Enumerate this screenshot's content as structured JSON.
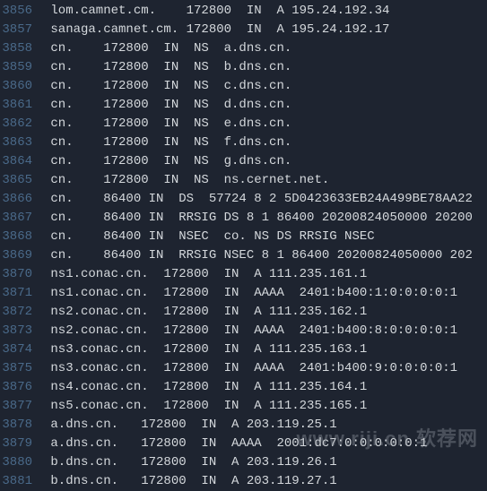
{
  "watermark": "www.riji.cn 软荐网",
  "lines": [
    {
      "num": "3856",
      "text": " lom.camnet.cm.    172800  IN  A 195.24.192.34"
    },
    {
      "num": "3857",
      "text": " sanaga.camnet.cm. 172800  IN  A 195.24.192.17"
    },
    {
      "num": "3858",
      "text": " cn.    172800  IN  NS  a.dns.cn."
    },
    {
      "num": "3859",
      "text": " cn.    172800  IN  NS  b.dns.cn."
    },
    {
      "num": "3860",
      "text": " cn.    172800  IN  NS  c.dns.cn."
    },
    {
      "num": "3861",
      "text": " cn.    172800  IN  NS  d.dns.cn."
    },
    {
      "num": "3862",
      "text": " cn.    172800  IN  NS  e.dns.cn."
    },
    {
      "num": "3863",
      "text": " cn.    172800  IN  NS  f.dns.cn."
    },
    {
      "num": "3864",
      "text": " cn.    172800  IN  NS  g.dns.cn."
    },
    {
      "num": "3865",
      "text": " cn.    172800  IN  NS  ns.cernet.net."
    },
    {
      "num": "3866",
      "text": " cn.    86400 IN  DS  57724 8 2 5D0423633EB24A499BE78AA22"
    },
    {
      "num": "3867",
      "text": " cn.    86400 IN  RRSIG DS 8 1 86400 20200824050000 20200"
    },
    {
      "num": "3868",
      "text": " cn.    86400 IN  NSEC  co. NS DS RRSIG NSEC"
    },
    {
      "num": "3869",
      "text": " cn.    86400 IN  RRSIG NSEC 8 1 86400 20200824050000 202"
    },
    {
      "num": "3870",
      "text": " ns1.conac.cn.  172800  IN  A 111.235.161.1"
    },
    {
      "num": "3871",
      "text": " ns1.conac.cn.  172800  IN  AAAA  2401:b400:1:0:0:0:0:1"
    },
    {
      "num": "3872",
      "text": " ns2.conac.cn.  172800  IN  A 111.235.162.1"
    },
    {
      "num": "3873",
      "text": " ns2.conac.cn.  172800  IN  AAAA  2401:b400:8:0:0:0:0:1"
    },
    {
      "num": "3874",
      "text": " ns3.conac.cn.  172800  IN  A 111.235.163.1"
    },
    {
      "num": "3875",
      "text": " ns3.conac.cn.  172800  IN  AAAA  2401:b400:9:0:0:0:0:1"
    },
    {
      "num": "3876",
      "text": " ns4.conac.cn.  172800  IN  A 111.235.164.1"
    },
    {
      "num": "3877",
      "text": " ns5.conac.cn.  172800  IN  A 111.235.165.1"
    },
    {
      "num": "3878",
      "text": " a.dns.cn.   172800  IN  A 203.119.25.1"
    },
    {
      "num": "3879",
      "text": " a.dns.cn.   172800  IN  AAAA  2001:dc7:0:0:0:0:0:1"
    },
    {
      "num": "3880",
      "text": " b.dns.cn.   172800  IN  A 203.119.26.1"
    },
    {
      "num": "3881",
      "text": " b.dns.cn.   172800  IN  A 203.119.27.1"
    }
  ]
}
